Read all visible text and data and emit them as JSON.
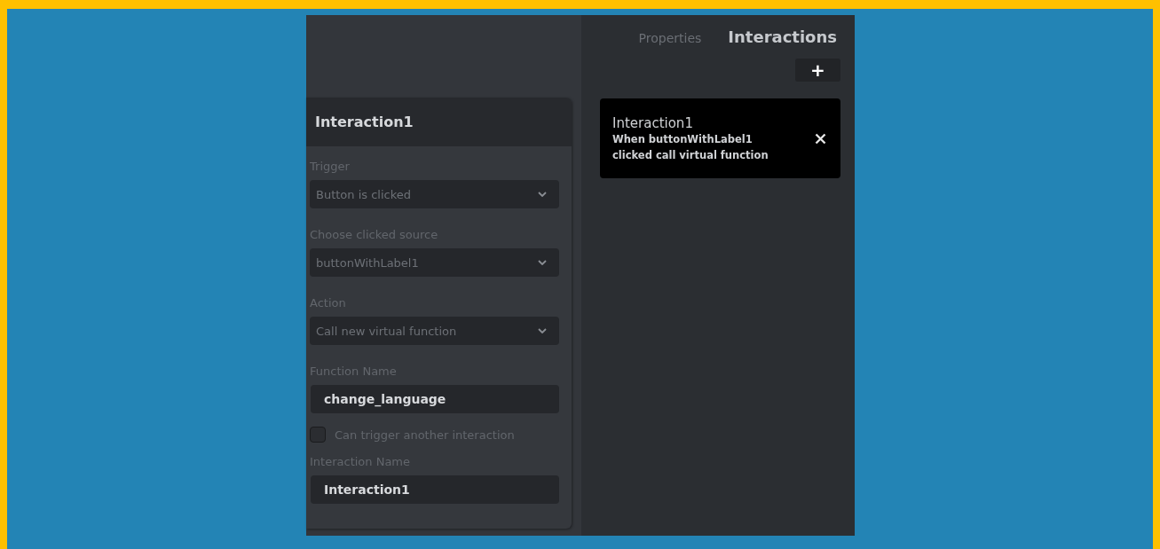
{
  "editor": {
    "title": "Interaction1",
    "fields": [
      {
        "kind": "select",
        "label": "Trigger",
        "value": "Button is clicked"
      },
      {
        "kind": "select",
        "label": "Choose clicked source",
        "value": "buttonWithLabel1"
      },
      {
        "kind": "select",
        "label": "Action",
        "value": "Call new virtual function"
      },
      {
        "kind": "input",
        "label": "Function Name",
        "value": "change_language"
      },
      {
        "kind": "checkbox",
        "label": "Can trigger another interaction",
        "checked": false
      },
      {
        "kind": "input",
        "label": "Interaction Name",
        "value": "Interaction1"
      }
    ]
  },
  "tabs": [
    {
      "label": "Properties",
      "selected": false
    },
    {
      "label": "Interactions",
      "selected": true
    }
  ],
  "add_button": {
    "label": "+"
  },
  "interactions": [
    {
      "title": "Interaction1",
      "description": "When buttonWithLabel1 clicked call virtual function"
    }
  ]
}
